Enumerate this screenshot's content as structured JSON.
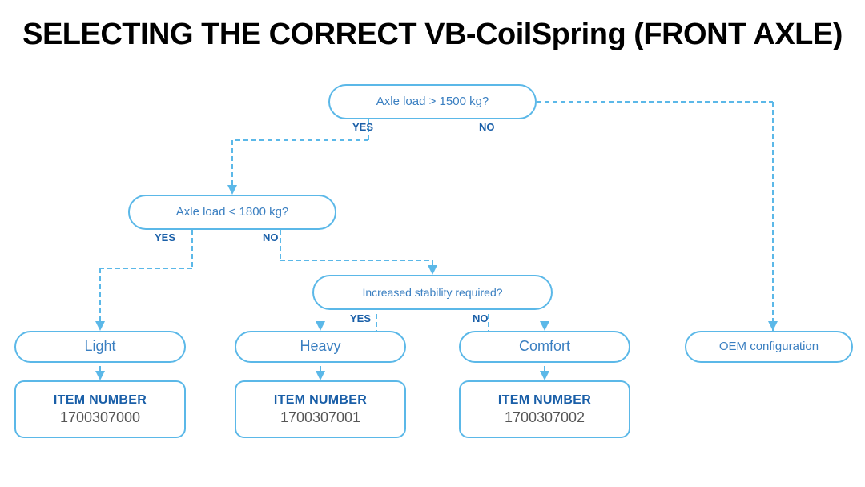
{
  "page": {
    "title": "SELECTING THE CORRECT VB-CoilSpring (FRONT AXLE)"
  },
  "diagram": {
    "decision1": {
      "text": "Axle load > 1500 kg?",
      "yes": "YES",
      "no": "NO"
    },
    "decision2": {
      "text": "Axle load < 1800 kg?",
      "yes": "YES",
      "no": "NO"
    },
    "decision3": {
      "text": "Increased stability required?",
      "yes": "YES",
      "no": "NO"
    },
    "result_light": "Light",
    "result_heavy": "Heavy",
    "result_comfort": "Comfort",
    "result_oem": "OEM configuration",
    "item1": {
      "label": "ITEM NUMBER",
      "number": "1700307000"
    },
    "item2": {
      "label": "ITEM NUMBER",
      "number": "1700307001"
    },
    "item3": {
      "label": "ITEM NUMBER",
      "number": "1700307002"
    }
  }
}
